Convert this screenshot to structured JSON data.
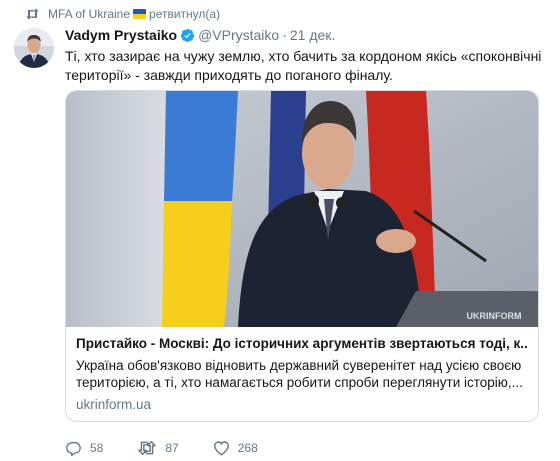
{
  "retweet": {
    "account": "MFA of Ukraine",
    "action": "ретвитнул(а)",
    "flag_colors": [
      "#1e5bbf",
      "#f7d117"
    ]
  },
  "tweet": {
    "display_name": "Vadym Prystaiko",
    "handle": "@VPrystaiko",
    "separator": "·",
    "timestamp": "21 дек.",
    "text": "Ті, хто зазирає на чужу землю, хто бачить за кордоном якісь «споконвічні території» - завжди приходять до поганого фіналу."
  },
  "card": {
    "watermark": "UKRINFORM",
    "title": "Пристайко - Москві: До історичних аргументів звертаються тоді, к...",
    "description_lines": [
      "Україна обов'язково відновить державний суверенітет над усією своєю",
      "територією, а ті, хто намагається робити спроби переглянути історію,..."
    ],
    "domain": "ukrinform.ua"
  },
  "actions": {
    "replies": "58",
    "retweets": "87",
    "likes": "268"
  },
  "colors": {
    "secondary_text": "#657786",
    "verified_blue": "#1da1f2",
    "card_border": "#d4dbe1"
  },
  "icons": [
    "retweet-icon",
    "ukraine-flag-icon",
    "verified-icon",
    "reply-icon",
    "like-icon"
  ]
}
